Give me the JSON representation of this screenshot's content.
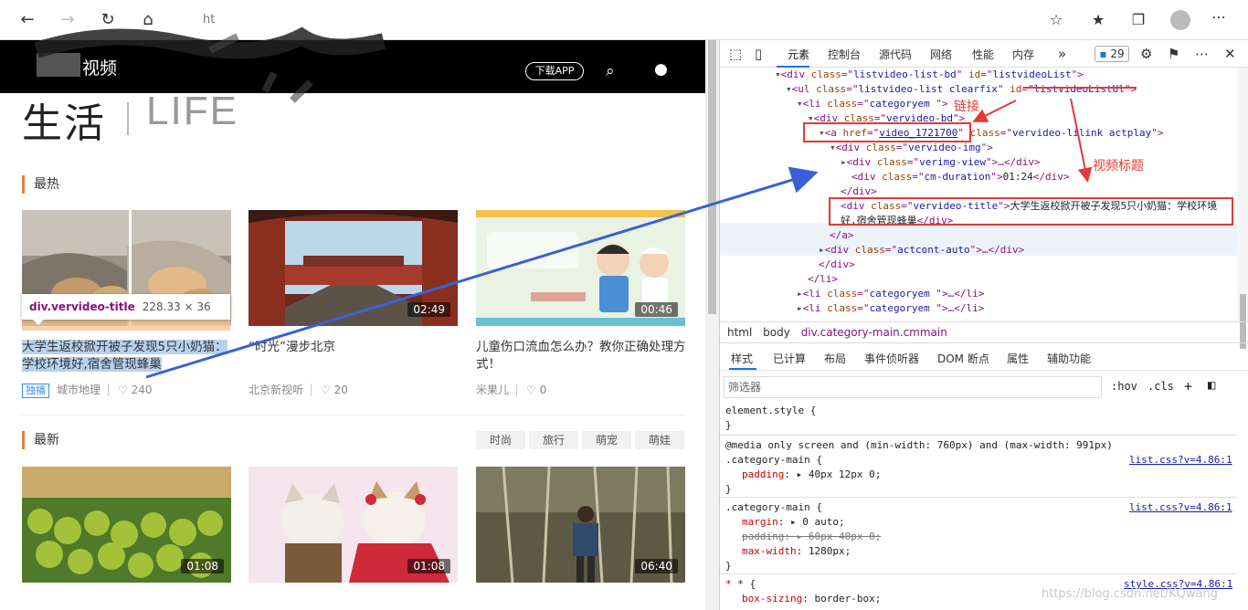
{
  "browser": {
    "url_visible_fragment": "ht",
    "extension_count": "29"
  },
  "site": {
    "logo_suffix": "视频",
    "download_button": "下载APP",
    "page_title_cn": "生活",
    "page_title_en": "LIFE"
  },
  "sections": {
    "hot": "最热",
    "newest": "最新"
  },
  "tags": [
    "时尚",
    "旅行",
    "萌宠",
    "萌娃"
  ],
  "hot_videos": [
    {
      "title": "大学生返校掀开被子发现5只小奶猫：学校环境好,宿舍管现蜂巢",
      "duration": "24",
      "source": "城市地理",
      "likes": "240",
      "badge": "独播"
    },
    {
      "title": "“时光”漫步北京",
      "duration": "02:49",
      "source": "北京新视听",
      "likes": "20"
    },
    {
      "title": "儿童伤口流血怎么办？教你正确处理方式！",
      "duration": "00:46",
      "source": "米果儿",
      "likes": "0"
    }
  ],
  "new_videos": [
    {
      "duration": "01:08"
    },
    {
      "duration": "01:08"
    },
    {
      "duration": "06:40"
    }
  ],
  "tooltip": {
    "selector": "div.vervideo-title",
    "size": "228.33 × 36"
  },
  "devtools": {
    "tabs": [
      "元素",
      "控制台",
      "源代码",
      "网络",
      "性能",
      "内存"
    ],
    "issues_badge": "29",
    "breadcrumbs": [
      "html",
      "body",
      "div.category-main.cmmain"
    ],
    "style_tabs": [
      "样式",
      "已计算",
      "布局",
      "事件侦听器",
      "DOM 断点",
      "属性",
      "辅助功能"
    ],
    "filter_placeholder": "筛选器",
    "hov": ":hov",
    "cls": ".cls",
    "dom": {
      "l1_tag": "div",
      "l1_attr1": "listvideo-list-bd",
      "l1_attr2": "listvideoList",
      "l2_tag": "ul",
      "l2_attr1": "listvideo-list clearfix",
      "l2_attr2": "listvideoListUl",
      "l3_attr": "categoryem ",
      "l4_attr": "vervideo-bd",
      "l5_href": "video_1721700",
      "l5_class": "vervideo-lilink actplay",
      "l6_attr": "vervideo-img",
      "l7_attr": "verimg-view",
      "l8_attr": "cm-duration",
      "l8_text": "01:24",
      "l10_attr": "vervideo-title",
      "l10_text1": "大学生返校掀开被子发现5只小奶猫：学校环境",
      "l10_text2": "好,宿舍管现蜂巢",
      "l13_attr": "actcont-auto",
      "l16_attr": "categoryem ",
      "l17_attr": "categoryem "
    },
    "styles": {
      "element_style": "element.style {",
      "media": "@media only screen and (min-width: 760px) and (max-width: 991px)",
      "sel1": ".category-main {",
      "src1": "list.css?v=4.86:1",
      "p1": "padding",
      "v1": "40px 12px 0;",
      "sel2": ".category-main {",
      "src2": "list.css?v=4.86:1",
      "p2a": "margin",
      "v2a": "0 auto;",
      "p2b": "padding",
      "v2b": "60px 40px 0;",
      "p2c": "max-width",
      "v2c": "1280px;",
      "sel3": "* {",
      "src3": "style.css?v=4.86:1",
      "p3": "box-sizing",
      "v3": "border-box;"
    }
  },
  "annotations": {
    "link": "链接",
    "video_title": "视频标题"
  },
  "watermark": "https://blog.csdn.net/KQwang"
}
